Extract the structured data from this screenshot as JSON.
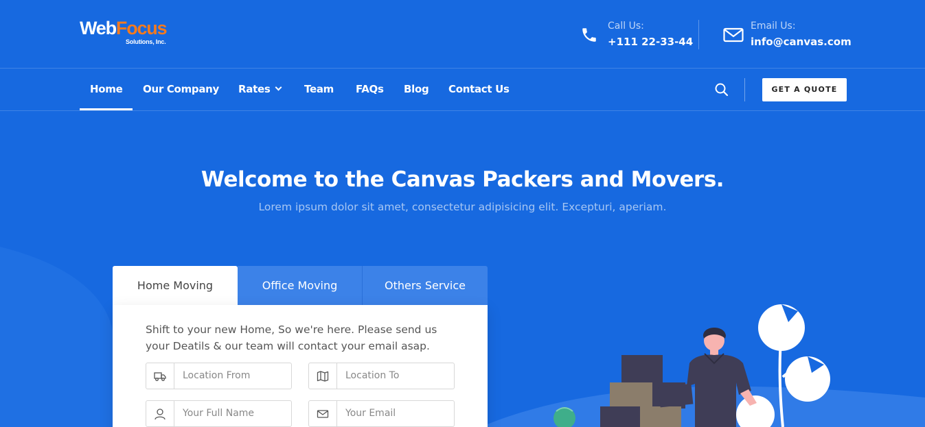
{
  "logo": {
    "part1": "Web",
    "part2": "Focus",
    "sub": "Solutions, Inc."
  },
  "header": {
    "phone": {
      "label": "Call Us:",
      "value": "+111 22-33-44",
      "icon": "phone-icon"
    },
    "email": {
      "label": "Email Us:",
      "value": "info@canvas.com",
      "icon": "mail-icon"
    }
  },
  "nav": {
    "items": [
      {
        "label": "Home",
        "active": true
      },
      {
        "label": "Our Company"
      },
      {
        "label": "Rates",
        "has_dropdown": true
      },
      {
        "label": "Team"
      },
      {
        "label": "FAQs"
      },
      {
        "label": "Blog"
      },
      {
        "label": "Contact Us"
      }
    ],
    "search_icon": "search-icon",
    "quote_label": "GET A QUOTE"
  },
  "hero": {
    "title": "Welcome to the Canvas Packers and Movers.",
    "subtitle": "Lorem ipsum dolor sit amet, consectetur adipisicing elit. Excepturi, aperiam."
  },
  "form": {
    "tabs": [
      {
        "label": "Home Moving",
        "active": true
      },
      {
        "label": "Office Moving"
      },
      {
        "label": "Others Service"
      }
    ],
    "intro": "Shift to your new Home, So we're here. Please send us your Deatils & our team will contact your email asap.",
    "fields": [
      {
        "placeholder": "Location From",
        "icon": "truck-icon"
      },
      {
        "placeholder": "Location To",
        "icon": "map-icon"
      },
      {
        "placeholder": "Your Full Name",
        "icon": "user-icon"
      },
      {
        "placeholder": "Your Email",
        "icon": "mail-icon"
      }
    ]
  },
  "colors": {
    "background": "#1769e0",
    "accent_orange": "#f47a1f",
    "tab_inactive": "#3c82e8",
    "white": "#ffffff"
  }
}
